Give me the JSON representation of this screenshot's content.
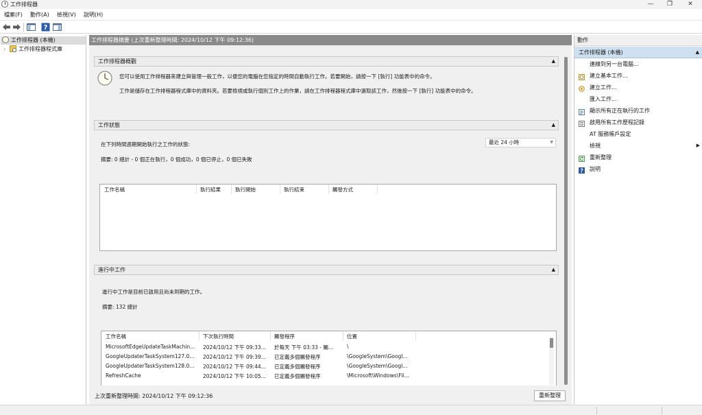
{
  "window": {
    "title": "工作排程器",
    "controls": [
      "—",
      "❐",
      "✕"
    ]
  },
  "menu": [
    "檔案(F)",
    "動作(A)",
    "檢視(V)",
    "說明(H)"
  ],
  "toolbar": [
    "back-icon",
    "forward-icon",
    "show-hide-tree-icon",
    "help-icon",
    "show-hide-action-pane-icon"
  ],
  "tree": {
    "root": "工作排程器 (本機)",
    "child": "工作排程器程式庫",
    "expander": "›"
  },
  "center": {
    "header": "工作排程器摘要 (上次重新整理時間: 2024/10/12 下午 09:12:36)",
    "overview": {
      "title": "工作排程器概觀",
      "line1": "您可以使用工作排程器來建立與管理一般工作，以便您的電腦在您指定的時間自動執行工作。若要開始，請按一下 [執行] 功能表中的命令。",
      "line2": "工作是儲存在工作排程器程式庫中的資料夾。若要檢視或執行個別工作上的作業，請在工作排程器程式庫中選取該工作，然後按一下 [執行] 功能表中的命令。"
    },
    "status": {
      "title": "工作狀態",
      "period_label": "在下列時間週期開始執行之工作的狀態:",
      "period_value": "最近 24 小時",
      "summary": "摘要: 0 總計 - 0 個正在執行，0 個成功，0 個已停止，0 個已失敗",
      "columns": [
        "工作名稱",
        "執行結果",
        "執行開始",
        "執行結束",
        "觸發方式"
      ]
    },
    "active": {
      "title": "進行中工作",
      "desc": "進行中工作是目前已啟用且尚未到期的工作。",
      "summary": "摘要: 132 總計",
      "columns": [
        "工作名稱",
        "下次執行時間",
        "觸發程序",
        "位置"
      ],
      "rows": [
        [
          "MicrosoftEdgeUpdateTaskMachin...",
          "2024/10/12 下午 09:33...",
          "於每天 下午 03:33 - 觸...",
          "\\"
        ],
        [
          "GoogleUpdaterTaskSystem127.0...",
          "2024/10/12 下午 09:39...",
          "已定義多個觸發程序",
          "\\GoogleSystem\\Googl..."
        ],
        [
          "GoogleUpdaterTaskSystem128.0...",
          "2024/10/12 下午 09:44...",
          "已定義多個觸發程序",
          "\\GoogleSystem\\Googl..."
        ],
        [
          "RefreshCache",
          "2024/10/12 下午 10:05...",
          "已定義多個觸發程序",
          "\\Microsoft\\Windows\\Fli..."
        ]
      ]
    },
    "footer": {
      "last_refresh": "上次重新整理時間: 2024/10/12 下午 09:12:36",
      "refresh_button": "重新整理"
    }
  },
  "actions": {
    "title": "動作",
    "group": "工作排程器 (本機)",
    "items": [
      {
        "label": "連線到另一台電腦...",
        "icon": ""
      },
      {
        "label": "建立基本工作...",
        "icon": "create-basic-task-icon"
      },
      {
        "label": "建立工作...",
        "icon": "create-task-icon"
      },
      {
        "label": "匯入工作...",
        "icon": ""
      },
      {
        "label": "顯示所有正在執行的工作",
        "icon": "running-tasks-icon"
      },
      {
        "label": "啟用所有工作歷程記錄",
        "icon": "history-icon"
      },
      {
        "label": "AT 服務帳戶設定",
        "icon": ""
      },
      {
        "label": "檢視",
        "icon": "",
        "submenu": "▶"
      },
      {
        "label": "重新整理",
        "icon": "refresh-icon"
      },
      {
        "label": "說明",
        "icon": "help-icon"
      }
    ]
  }
}
